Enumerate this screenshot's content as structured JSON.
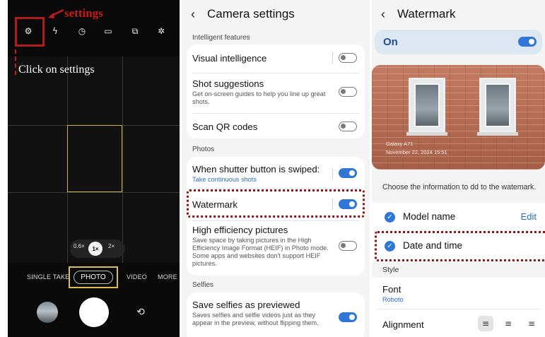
{
  "annotations": {
    "settings_label": "settings",
    "instruction": "Click on settings"
  },
  "camera": {
    "zoom_options": [
      "0.6×",
      "1×",
      "2×"
    ],
    "selected_zoom": "1×",
    "modes": [
      "SINGLE TAKE",
      "PHOTO",
      "VIDEO",
      "MORE"
    ],
    "selected_mode": "PHOTO",
    "top_icons": [
      "settings-gear",
      "flash",
      "timer",
      "aspect-ratio",
      "motion-photo",
      "filters"
    ]
  },
  "settings": {
    "title": "Camera settings",
    "section_intelligent": "Intelligent features",
    "visual_intelligence": {
      "label": "Visual intelligence",
      "on": false
    },
    "shot_suggestions": {
      "label": "Shot suggestions",
      "sub": "Get on-screen guides to help you line up great shots.",
      "on": false
    },
    "scan_qr": {
      "label": "Scan QR codes",
      "on": false
    },
    "section_photos": "Photos",
    "shutter_swiped": {
      "label": "When shutter button is swiped:",
      "sub": "Take continuous shots",
      "on": true
    },
    "watermark": {
      "label": "Watermark",
      "on": true
    },
    "high_efficiency": {
      "label": "High efficiency pictures",
      "sub": "Save space by taking pictures in the High Efficiency Image Format (HEIF) in Photo mode. Some apps and websites don't support HEIF pictures.",
      "on": false
    },
    "section_selfies": "Selfies",
    "save_selfies": {
      "label": "Save selfies as previewed",
      "sub": "Saves selfies and selfie videos just as they appear in the preview, without flipping them.",
      "on": true
    }
  },
  "watermark": {
    "title": "Watermark",
    "on_label": "On",
    "on": true,
    "preview_model": "Galaxy A71",
    "preview_date": "November 22, 2024 15:51",
    "prompt": "Choose the information to dd to the watemark.",
    "model_name": "Model name",
    "edit": "Edit",
    "date_time": "Date and time",
    "style_section": "Style",
    "font_label": "Font",
    "font_value": "Roboto",
    "alignment_label": "Alignment",
    "alignment_selected": "left"
  },
  "colors": {
    "annotation_red": "#c21b1b",
    "toggle_blue": "#2f77d6",
    "highlight_yellow": "#d8c04b"
  }
}
